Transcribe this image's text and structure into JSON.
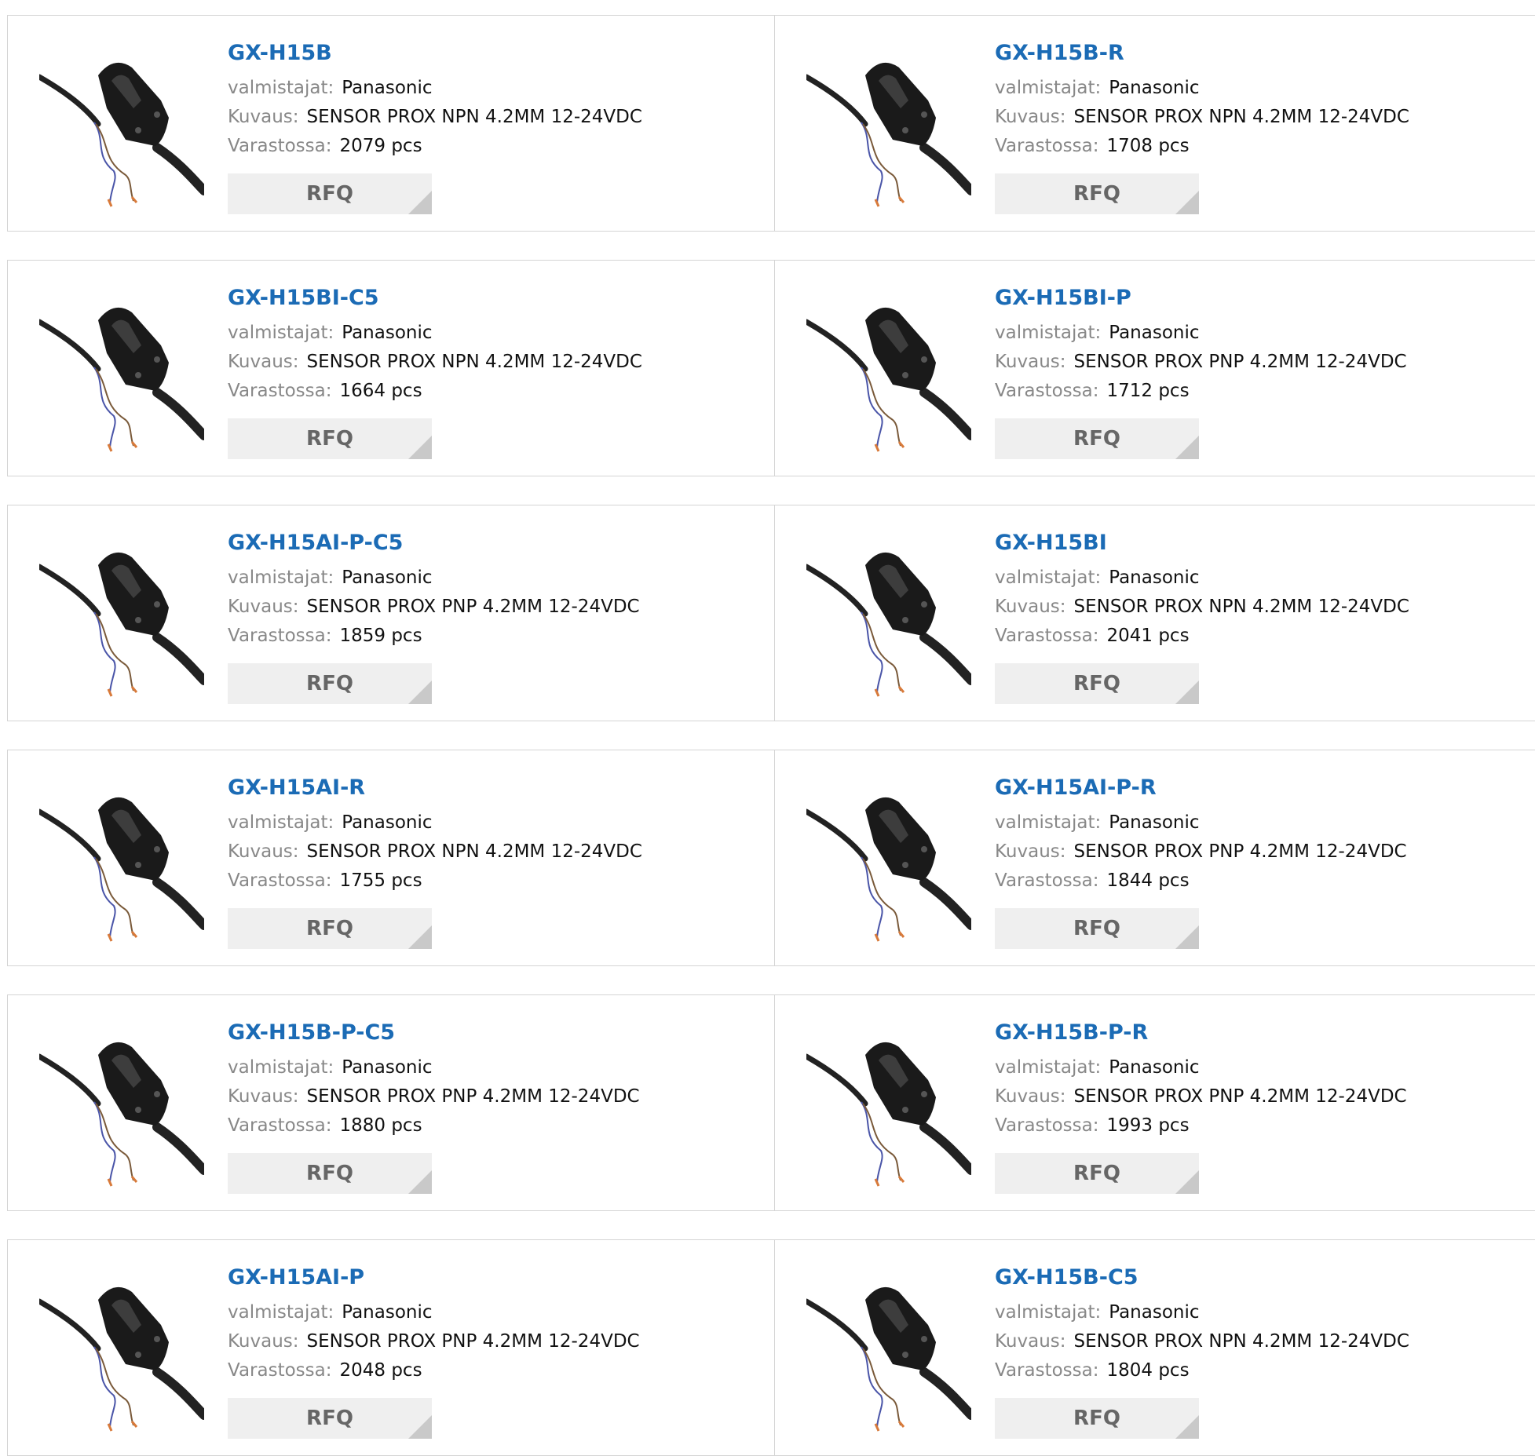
{
  "labels": {
    "manufacturer": "valmistajat:",
    "description": "Kuvaus:",
    "stock": "Varastossa:",
    "rfq": "RFQ"
  },
  "products": [
    {
      "part": "GX-H15B",
      "manufacturer": "Panasonic",
      "description": "SENSOR PROX NPN 4.2MM 12-24VDC",
      "stock": "2079 pcs"
    },
    {
      "part": "GX-H15B-R",
      "manufacturer": "Panasonic",
      "description": "SENSOR PROX NPN 4.2MM 12-24VDC",
      "stock": "1708 pcs"
    },
    {
      "part": "GX-H15BI-C5",
      "manufacturer": "Panasonic",
      "description": "SENSOR PROX NPN 4.2MM 12-24VDC",
      "stock": "1664 pcs"
    },
    {
      "part": "GX-H15BI-P",
      "manufacturer": "Panasonic",
      "description": "SENSOR PROX PNP 4.2MM 12-24VDC",
      "stock": "1712 pcs"
    },
    {
      "part": "GX-H15AI-P-C5",
      "manufacturer": "Panasonic",
      "description": "SENSOR PROX PNP 4.2MM 12-24VDC",
      "stock": "1859 pcs"
    },
    {
      "part": "GX-H15BI",
      "manufacturer": "Panasonic",
      "description": "SENSOR PROX NPN 4.2MM 12-24VDC",
      "stock": "2041 pcs"
    },
    {
      "part": "GX-H15AI-R",
      "manufacturer": "Panasonic",
      "description": "SENSOR PROX NPN 4.2MM 12-24VDC",
      "stock": "1755 pcs"
    },
    {
      "part": "GX-H15AI-P-R",
      "manufacturer": "Panasonic",
      "description": "SENSOR PROX PNP 4.2MM 12-24VDC",
      "stock": "1844 pcs"
    },
    {
      "part": "GX-H15B-P-C5",
      "manufacturer": "Panasonic",
      "description": "SENSOR PROX PNP 4.2MM 12-24VDC",
      "stock": "1880 pcs"
    },
    {
      "part": "GX-H15B-P-R",
      "manufacturer": "Panasonic",
      "description": "SENSOR PROX PNP 4.2MM 12-24VDC",
      "stock": "1993 pcs"
    },
    {
      "part": "GX-H15AI-P",
      "manufacturer": "Panasonic",
      "description": "SENSOR PROX PNP 4.2MM 12-24VDC",
      "stock": "2048 pcs"
    },
    {
      "part": "GX-H15B-C5",
      "manufacturer": "Panasonic",
      "description": "SENSOR PROX NPN 4.2MM 12-24VDC",
      "stock": "1804 pcs"
    }
  ],
  "colors": {
    "title": "#1b6bb5",
    "label": "#888888",
    "border": "#d4d4d4",
    "button_bg": "#efefef",
    "button_text": "#666666"
  },
  "icons": {
    "thumbnail": "proximity-sensor-icon",
    "button_corner": "triangle-corner-icon"
  }
}
